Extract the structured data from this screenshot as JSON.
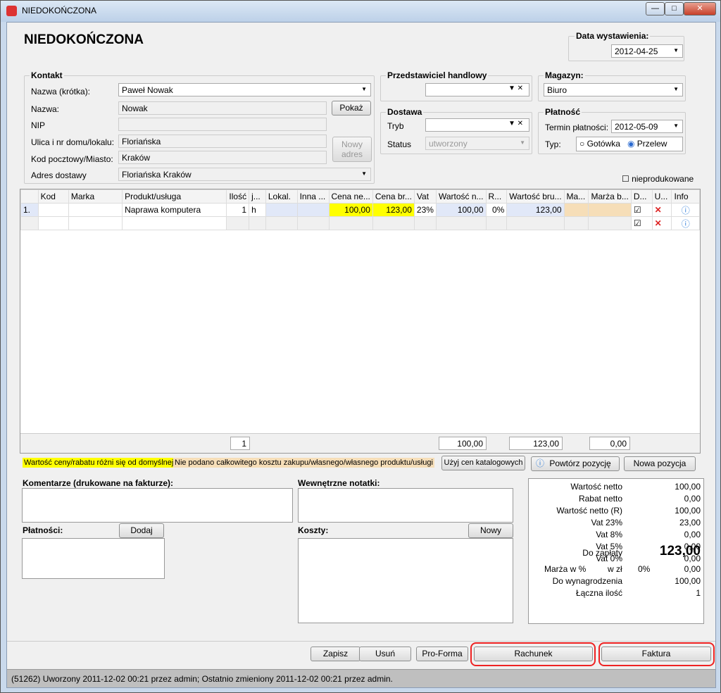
{
  "window": {
    "title": "NIEDOKOŃCZONA",
    "min": "—",
    "max": "□",
    "close": "✕"
  },
  "header": {
    "title": "NIEDOKOŃCZONA",
    "date_label": "Data wystawienia:",
    "date_value": "2012-04-25"
  },
  "kontakt": {
    "title": "Kontakt",
    "nazwa_krotka_label": "Nazwa (krótka):",
    "nazwa_krotka": "Paweł Nowak",
    "nazwa_label": "Nazwa:",
    "nazwa": "Nowak",
    "pokaz": "Pokaż",
    "nip_label": "NIP",
    "nip": "",
    "ulica_label": "Ulica i nr domu/lokalu:",
    "ulica": "Floriańska",
    "kod_label": "Kod pocztowy/Miasto:",
    "kod": "Kraków",
    "nowy_adres": "Nowy adres",
    "adres_label": "Adres dostawy",
    "adres": "Floriańska Kraków"
  },
  "przedstawiciel": {
    "title": "Przedstawiciel handlowy",
    "value": ""
  },
  "dostawa": {
    "title": "Dostawa",
    "tryb_label": "Tryb",
    "tryb": "",
    "status_label": "Status",
    "status": "utworzony"
  },
  "magazyn": {
    "title": "Magazyn:",
    "value": "Biuro"
  },
  "platnosc": {
    "title": "Płatność",
    "termin_label": "Termin płatności:",
    "termin": "2012-05-09",
    "typ_label": "Typ:",
    "gotowka": "Gotówka",
    "przelew": "Przelew",
    "selected": "Przelew"
  },
  "nieprodukowane": "nieprodukowane",
  "grid": {
    "columns": [
      "",
      "Kod",
      "Marka",
      "Produkt/usługa",
      "Ilość",
      "j...",
      "Lokal.",
      "Inna ...",
      "Cena ne...",
      "Cena br...",
      "Vat",
      "Wartość n...",
      "R...",
      "Wartość bru...",
      "Ma...",
      "Marża b...",
      "D...",
      "U...",
      "Info"
    ],
    "rows": [
      {
        "no": "1.",
        "kod": "",
        "marka": "",
        "produkt": "Naprawa komputera",
        "ilosc": "1",
        "jm": "h",
        "cena_netto": "100,00",
        "cena_brutto": "123,00",
        "vat": "23%",
        "wartosc_netto": "100,00",
        "rabat": "0%",
        "wartosc_brutto": "123,00"
      }
    ],
    "totals": {
      "ilosc": "1",
      "netto": "100,00",
      "brutto": "123,00",
      "marza": "0,00"
    }
  },
  "legend": {
    "yellow": "Wartość ceny/rabatu różni się od domyślnej",
    "orange": "Nie podano całkowitego kosztu zakupu/własnego/własnego produktu/usługi",
    "yellow_color": "#ffff00",
    "orange_color": "#f6deb8"
  },
  "buttons": {
    "katalog": "Użyj cen katalogowych",
    "powtorz": "Powtórz pozycję",
    "nowa": "Nowa pozycja",
    "dodaj": "Dodaj",
    "nowy": "Nowy",
    "zapisz": "Zapisz",
    "usun": "Usuń",
    "proforma": "Pro-Forma",
    "rachunek": "Rachunek",
    "faktura": "Faktura"
  },
  "sections": {
    "komentarze": "Komentarze (drukowane na fakturze):",
    "notatki": "Wewnętrzne notatki:",
    "platnosci": "Płatności:",
    "koszty": "Koszty:"
  },
  "summary": [
    [
      "Wartość netto",
      "100,00"
    ],
    [
      "Rabat netto",
      "0,00"
    ],
    [
      "Wartość netto (R)",
      "100,00"
    ],
    [
      "Vat 23%",
      "23,00"
    ],
    [
      "Vat 8%",
      "0,00"
    ],
    [
      "Vat 5%",
      "0,00"
    ],
    [
      "Vat 0%",
      "0,00"
    ]
  ],
  "summary2": {
    "do_zaplaty_label": "Do zapłaty",
    "do_zaplaty": "123,00",
    "marza_label": "Marża w %",
    "wzl_label": "w zł",
    "marza_pct": "0%",
    "marza_zl": "0,00",
    "wynagr_label": "Do wynagrodzenia",
    "wynagr": "100,00",
    "ilosc_label": "Łączna ilość",
    "ilosc": "1"
  },
  "status": "(51262) Uworzony 2011-12-02 00:21 przez admin; Ostatnio zmieniony 2011-12-02 00:21 przez admin."
}
